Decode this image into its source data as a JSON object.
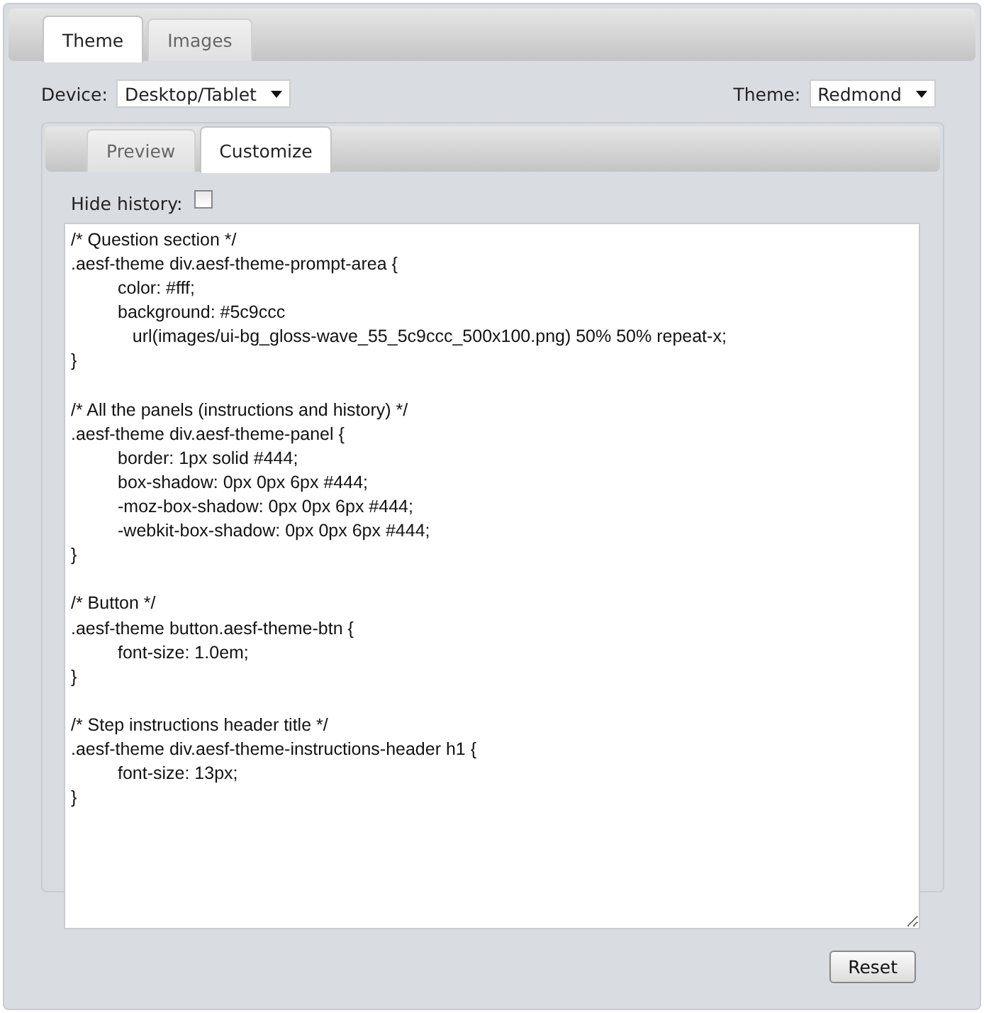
{
  "tabs": [
    {
      "label": "Theme",
      "selected": true
    },
    {
      "label": "Images",
      "selected": false
    }
  ],
  "device": {
    "label": "Device:",
    "value": "Desktop/Tablet"
  },
  "theme": {
    "label": "Theme:",
    "value": "Redmond"
  },
  "inner_tabs": [
    {
      "label": "Preview",
      "selected": false
    },
    {
      "label": "Customize",
      "selected": true
    }
  ],
  "hide_history": {
    "label": "Hide history:",
    "checked": false
  },
  "css_editor": {
    "value": "/* Question section */\n.aesf-theme div.aesf-theme-prompt-area {\n\tcolor: #fff;\n\tbackground: #5c9ccc\n\t   url(images/ui-bg_gloss-wave_55_5c9ccc_500x100.png) 50% 50% repeat-x;\n}\n\n/* All the panels (instructions and history) */\n.aesf-theme div.aesf-theme-panel {\n\tborder: 1px solid #444;\n\tbox-shadow: 0px 0px 6px #444;\n\t-moz-box-shadow: 0px 0px 6px #444;\n\t-webkit-box-shadow: 0px 0px 6px #444;\n}\n\n/* Button */\n.aesf-theme button.aesf-theme-btn {\n\tfont-size: 1.0em;\n}\n\n/* Step instructions header title */\n.aesf-theme div.aesf-theme-instructions-header h1 {\n\tfont-size: 13px;\n}"
  },
  "reset_button": "Reset"
}
